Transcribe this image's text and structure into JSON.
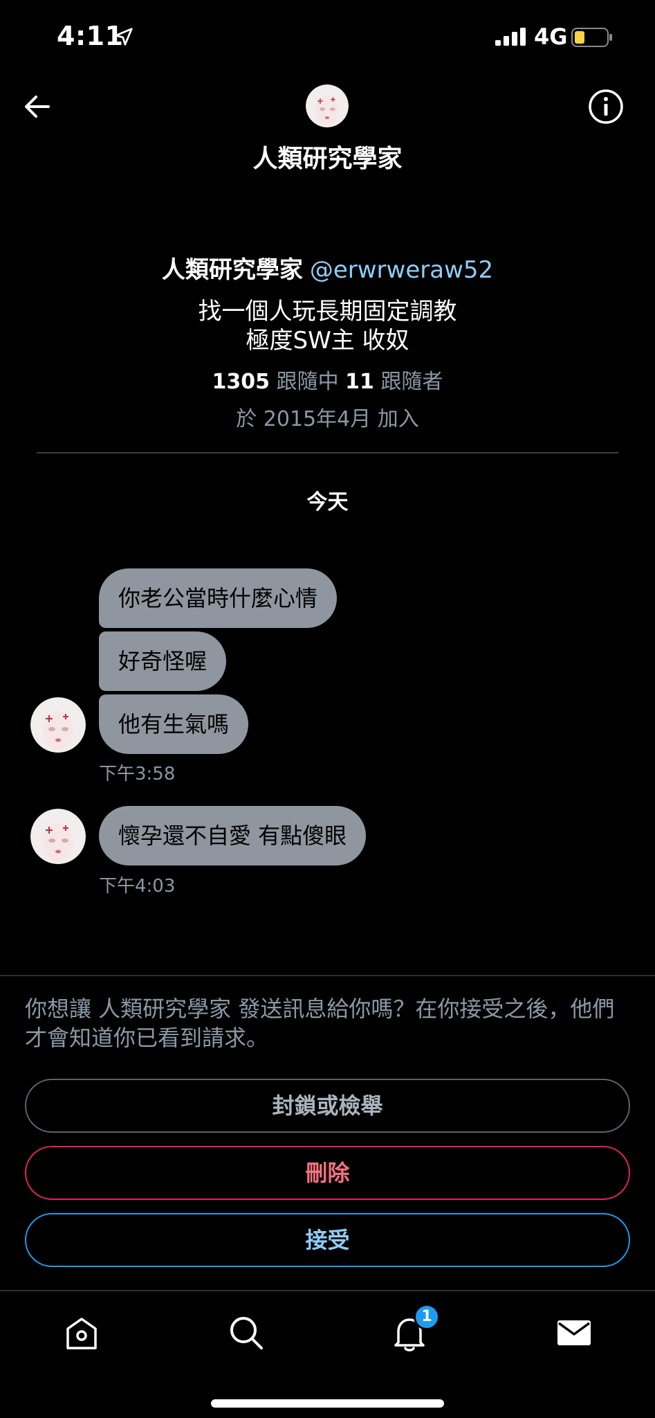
{
  "status_bar": {
    "time": "4:11",
    "network": "4G"
  },
  "header": {
    "title": "人類研究學家"
  },
  "profile": {
    "name": "人類研究學家",
    "handle": "@erwrweraw52",
    "bio_line1": "找一個人玩長期固定調教",
    "bio_line2": "極度SW主 收奴",
    "following_count": "1305",
    "following_label": "跟隨中",
    "followers_count": "11",
    "followers_label": "跟隨者",
    "joined": "於 2015年4月 加入"
  },
  "conversation": {
    "date_separator": "今天",
    "messages": [
      {
        "text": "你老公當時什麼心情"
      },
      {
        "text": "好奇怪喔"
      },
      {
        "text": "他有生氣嗎"
      },
      {
        "text": "懷孕還不自愛 有點傻眼"
      }
    ],
    "timestamps": [
      "下午3:58",
      "下午4:03"
    ]
  },
  "request": {
    "prompt": "你想讓 人類研究學家 發送訊息給你嗎？在你接受之後，他們才會知道你已看到請求。",
    "block_label": "封鎖或檢舉",
    "delete_label": "刪除",
    "accept_label": "接受"
  },
  "tab_bar": {
    "items": [
      {
        "icon": "home-icon"
      },
      {
        "icon": "search-icon"
      },
      {
        "icon": "bell-icon",
        "badge": "1"
      },
      {
        "icon": "mail-icon"
      }
    ]
  },
  "colors": {
    "background": "#000000",
    "bubble": "#8f969f",
    "link_blue": "#8ecdf8",
    "accent_blue": "#1d9bf0",
    "delete_red": "#e0245e",
    "secondary_text": "#8b98a5",
    "battery_yellow": "#f5d547"
  }
}
